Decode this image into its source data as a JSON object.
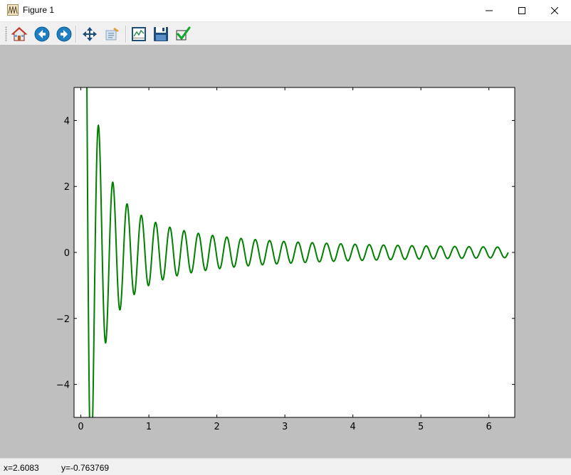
{
  "window": {
    "title": "Figure 1",
    "controls": [
      "minimize",
      "maximize",
      "close"
    ]
  },
  "toolbar": {
    "buttons": [
      {
        "name": "home",
        "icon": "home-icon",
        "tooltip": "Reset original view"
      },
      {
        "name": "back",
        "icon": "back-arrow-icon",
        "tooltip": "Back to previous view"
      },
      {
        "name": "forward",
        "icon": "forward-arrow-icon",
        "tooltip": "Forward to next view"
      },
      {
        "name": "pan",
        "icon": "pan-move-icon",
        "tooltip": "Pan axes"
      },
      {
        "name": "zoom",
        "icon": "zoom-rect-icon",
        "tooltip": "Zoom to rectangle"
      },
      {
        "name": "subplots",
        "icon": "subplots-icon",
        "tooltip": "Configure subplots"
      },
      {
        "name": "save",
        "icon": "save-disk-icon",
        "tooltip": "Save the figure"
      },
      {
        "name": "edit",
        "icon": "checkmark-icon",
        "tooltip": "Edit curves"
      }
    ]
  },
  "status": {
    "x": "x=2.6083",
    "y": "y=-0.763769"
  },
  "chart_data": {
    "type": "line",
    "title": "",
    "xlabel": "",
    "ylabel": "",
    "xlim": [
      -0.1,
      6.38
    ],
    "ylim": [
      -5,
      5
    ],
    "xticks": [
      0,
      1,
      2,
      3,
      4,
      5,
      6
    ],
    "xtick_labels": [
      "0",
      "1",
      "2",
      "3",
      "4",
      "5",
      "6"
    ],
    "yticks": [
      -4,
      -2,
      0,
      2,
      4
    ],
    "ytick_labels": [
      "−4",
      "−2",
      "0",
      "2",
      "4"
    ],
    "grid": false,
    "legend": "none",
    "series": [
      {
        "color": "#008000",
        "function": "sin(30*x)/x",
        "x_range": [
          0.01,
          6.2832
        ]
      }
    ],
    "colors": {
      "figure_bg": "#bfbfbf",
      "axes_bg": "#ffffff",
      "line": "#008000"
    }
  }
}
